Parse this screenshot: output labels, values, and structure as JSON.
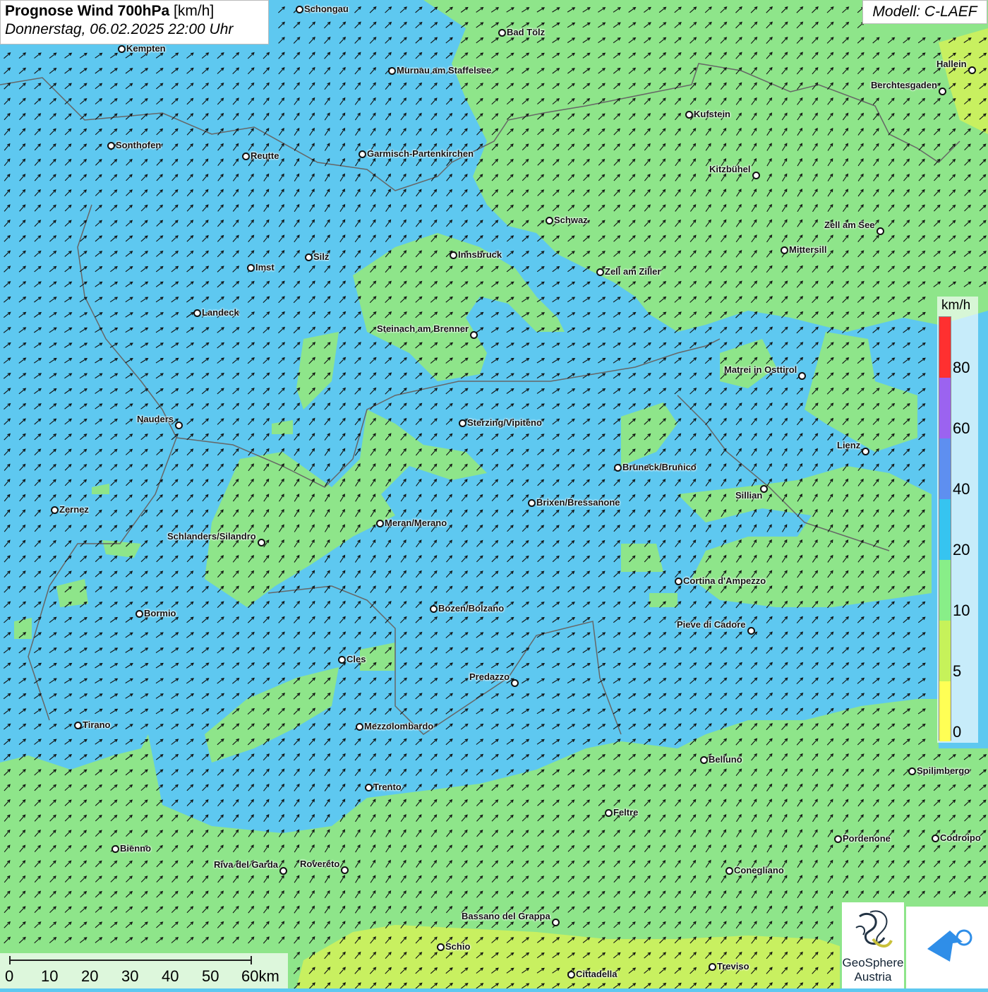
{
  "header": {
    "title_bold": "Prognose Wind 700hPa",
    "title_unit": "[km/h]",
    "date_line": "Donnerstag, 06.02.2025 22:00 Uhr",
    "model": "Modell: C-LAEF"
  },
  "legend": {
    "unit": "km/h",
    "labels": [
      "80",
      "60",
      "40",
      "20",
      "10",
      "5",
      "0"
    ],
    "colors": [
      "#ff3030",
      "#9b63f0",
      "#5e8ff0",
      "#36c4f0",
      "#88ee88",
      "#c6f25a",
      "#ffff55"
    ]
  },
  "scalebar": {
    "labels": [
      "0",
      "10",
      "20",
      "30",
      "40",
      "50",
      "60km"
    ]
  },
  "logos": {
    "geosphere_line1": "GeoSphere",
    "geosphere_line2": "Austria"
  },
  "colors": {
    "wind_low": "#8ee58a",
    "wind_mid": "#5ec8f0",
    "wind_weak": "#c8f060",
    "arrow": "#111111"
  },
  "wind_direction": "southwest-to-northeast",
  "cities": [
    {
      "name": "Schongau"
    },
    {
      "name": "Bad Tölz"
    },
    {
      "name": "Kempten"
    },
    {
      "name": "Murnau am Staffelsee"
    },
    {
      "name": "Hallein"
    },
    {
      "name": "Berchtesgaden"
    },
    {
      "name": "Kufstein"
    },
    {
      "name": "Sonthofen"
    },
    {
      "name": "Reutte"
    },
    {
      "name": "Garmisch-Partenkirchen"
    },
    {
      "name": "Kitzbühel"
    },
    {
      "name": "Schwaz"
    },
    {
      "name": "Zell am See"
    },
    {
      "name": "Innsbruck"
    },
    {
      "name": "Mittersill"
    },
    {
      "name": "Silz"
    },
    {
      "name": "Imst"
    },
    {
      "name": "Zell am Ziller"
    },
    {
      "name": "Landeck"
    },
    {
      "name": "Steinach am Brenner"
    },
    {
      "name": "Matrei in Osttirol"
    },
    {
      "name": "Nauders"
    },
    {
      "name": "Sterzing/Vipiteno"
    },
    {
      "name": "Lienz"
    },
    {
      "name": "Bruneck/Brunico"
    },
    {
      "name": "Sillian"
    },
    {
      "name": "Zernez"
    },
    {
      "name": "Brixen/Bressanone"
    },
    {
      "name": "Meran/Merano"
    },
    {
      "name": "Schlanders/Silandro"
    },
    {
      "name": "Cortina d'Ampezzo"
    },
    {
      "name": "Bormio"
    },
    {
      "name": "Bozen/Bolzano"
    },
    {
      "name": "Pieve di Cadore"
    },
    {
      "name": "Cles"
    },
    {
      "name": "Predazzo"
    },
    {
      "name": "Tirano"
    },
    {
      "name": "Mezzolombardo"
    },
    {
      "name": "Belluno"
    },
    {
      "name": "Spilimbergo"
    },
    {
      "name": "Trento"
    },
    {
      "name": "Feltre"
    },
    {
      "name": "Pordenone"
    },
    {
      "name": "Codroipo"
    },
    {
      "name": "Bienno"
    },
    {
      "name": "Riva del Garda"
    },
    {
      "name": "Rovereto"
    },
    {
      "name": "Conegliano"
    },
    {
      "name": "Bassano del Grappa"
    },
    {
      "name": "Schio"
    },
    {
      "name": "Treviso"
    },
    {
      "name": "Cittadella"
    }
  ]
}
